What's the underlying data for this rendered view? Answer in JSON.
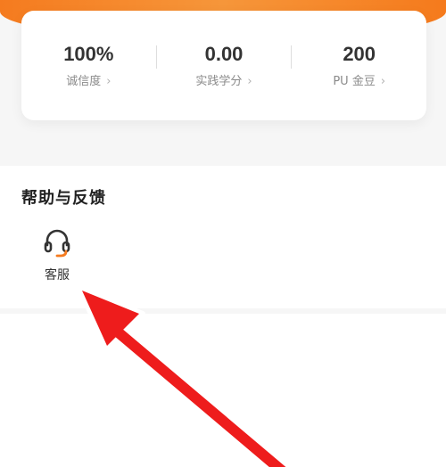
{
  "stats": [
    {
      "value": "100%",
      "label": "诚信度"
    },
    {
      "value": "0.00",
      "label": "实践学分"
    },
    {
      "value": "200",
      "label": "PU 金豆"
    }
  ],
  "help_section": {
    "title": "帮助与反馈",
    "items": [
      {
        "label": "客服",
        "icon": "headset-icon"
      }
    ]
  },
  "colors": {
    "accent": "#f57b1f",
    "arrow": "#ee1c1c"
  }
}
